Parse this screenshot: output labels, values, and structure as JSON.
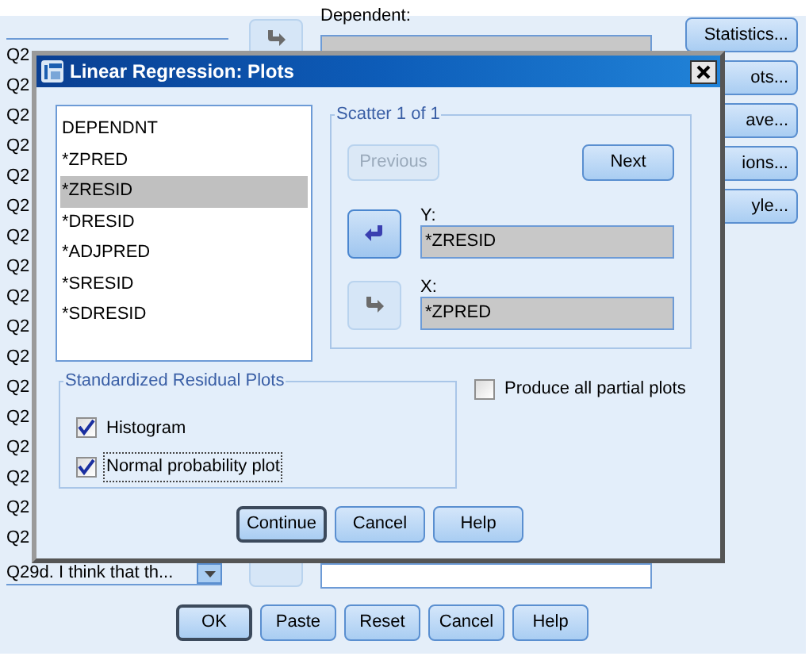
{
  "background_dialog": {
    "variable_list": [
      "Q2",
      "Q2",
      "Q2",
      "Q2",
      "Q2",
      "Q2",
      "Q2",
      "Q2",
      "Q2",
      "Q2",
      "Q2",
      "Q2",
      "Q2",
      "Q2",
      "Q2",
      "Q2",
      "Q2"
    ],
    "dropdown_item": "Q29d. I think that th...",
    "dependent_label": "Dependent:",
    "side_buttons": [
      "Statistics...",
      "ots...",
      "ave...",
      "ions...",
      "yle..."
    ],
    "buttons": [
      "OK",
      "Paste",
      "Reset",
      "Cancel",
      "Help"
    ]
  },
  "dialog": {
    "title": "Linear Regression: Plots",
    "source_list": [
      {
        "label": "DEPENDNT",
        "selected": false
      },
      {
        "label": "*ZPRED",
        "selected": false
      },
      {
        "label": "*ZRESID",
        "selected": true
      },
      {
        "label": "*DRESID",
        "selected": false
      },
      {
        "label": "*ADJPRED",
        "selected": false
      },
      {
        "label": "*SRESID",
        "selected": false
      },
      {
        "label": "*SDRESID",
        "selected": false
      }
    ],
    "scatter": {
      "title": "Scatter 1 of 1",
      "previous": {
        "label": "Previous",
        "disabled": true
      },
      "next": {
        "label": "Next",
        "disabled": false
      },
      "targets": [
        {
          "label": "Y:",
          "value": "*ZRESID",
          "kind": "back"
        },
        {
          "label": "X:",
          "value": "*ZPRED",
          "kind": "forward"
        }
      ]
    },
    "residual_group": {
      "title": "Standardized Residual Plots",
      "options": [
        {
          "label": "Histogram",
          "checked": true,
          "focused": false
        },
        {
          "label": "Normal probability plot",
          "checked": true,
          "focused": true
        }
      ]
    },
    "partial_plots": {
      "label": "Produce all partial plots",
      "checked": false
    },
    "buttons": [
      {
        "label": "Continue",
        "default": true
      },
      {
        "label": "Cancel",
        "default": false
      },
      {
        "label": "Help",
        "default": false
      }
    ]
  }
}
